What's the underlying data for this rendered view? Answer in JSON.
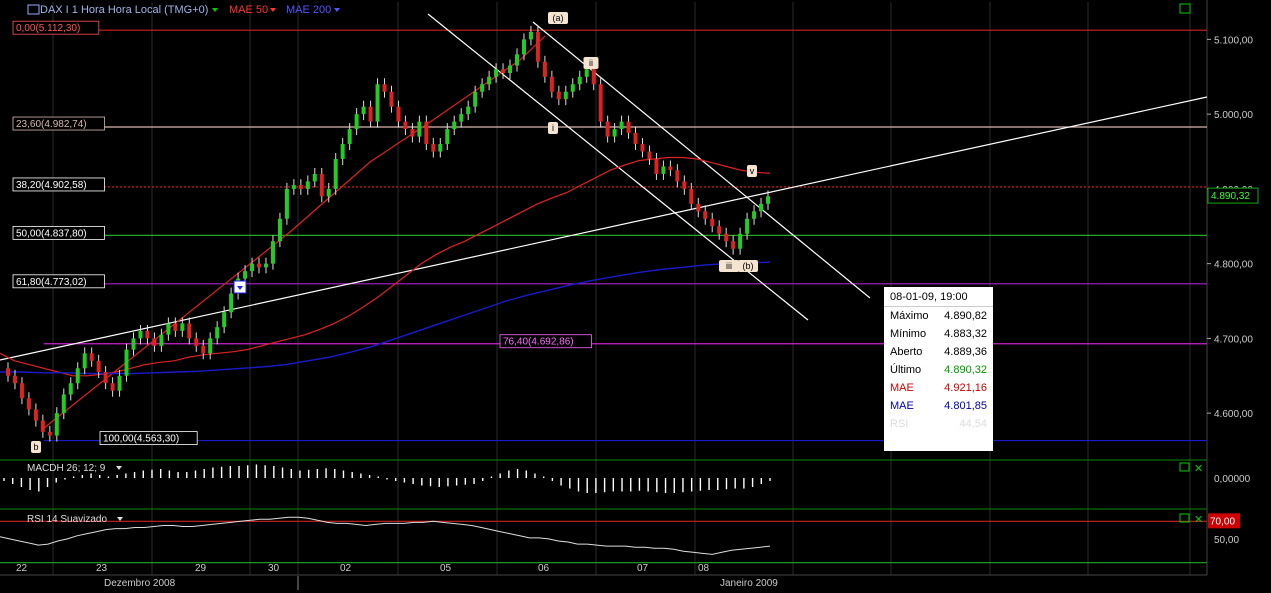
{
  "header": {
    "symbol_title": "DAX I 1 Hora Hora Local (TMG+0)",
    "ma1_label": "MAE 50",
    "ma2_label": "MAE 200"
  },
  "colors": {
    "background": "#000000",
    "candle_up": "#22cc22",
    "candle_down": "#dd2222",
    "mae50": "#dd2222",
    "mae200": "#1a1acc",
    "fib_100": "#1a1acc",
    "fib_0": "#cc2222",
    "fib_236": "#d8b8b0",
    "fib_50": "#22aa22",
    "fib_618": "#aa22cc",
    "fib_764": "#cc22cc",
    "rsi_70": "#cc2222",
    "white_line": "#ffffff",
    "grid": "#2a2a2a"
  },
  "fib_labels": [
    {
      "text": "0,00(5.112,30)",
      "value": 5112.3,
      "color": "#cc2222",
      "tagcolor": "#ff5555"
    },
    {
      "text": "23,60(4.982,74)",
      "value": 4982.74,
      "color": "#d8b8b0",
      "tagcolor": "#d8b8b0"
    },
    {
      "text": "38,20(4.902,58)",
      "value": 4902.58,
      "color": "#dd2222",
      "tagcolor": "#ffffff",
      "dotted": true
    },
    {
      "text": "50,00(4.837,80)",
      "value": 4837.8,
      "color": "#22aa22",
      "tagcolor": "#ffffff"
    },
    {
      "text": "61,80(4.773,02)",
      "value": 4773.02,
      "color": "#aa22cc",
      "tagcolor": "#ffffff"
    },
    {
      "text": "76,40(4.692,86)",
      "value": 4692.86,
      "color": "#cc22cc",
      "tagcolor": "#ff66ff"
    },
    {
      "text": "100,00(4.563,30)",
      "value": 4563.3,
      "color": "#1a1acc",
      "tagcolor": "#ffffff"
    }
  ],
  "wave_labels": [
    "(a)",
    "ii",
    "i",
    "v",
    "iii",
    "(b)",
    "b",
    "iv"
  ],
  "last_price_tag": "4.890,32",
  "tooltip": {
    "header": "08-01-09, 19:00",
    "rows": [
      {
        "label": "Máximo",
        "value": "4.890,82",
        "color": "#000000"
      },
      {
        "label": "Mínimo",
        "value": "4.883,32",
        "color": "#000000"
      },
      {
        "label": "Aberto",
        "value": "4.889,36",
        "color": "#000000"
      },
      {
        "label": "Último",
        "value": "4.890,32",
        "color": "#009900"
      },
      {
        "label": "MAE",
        "value": "4.921,16",
        "color": "#cc0000"
      },
      {
        "label": "MAE",
        "value": "4.801,85",
        "color": "#0000aa"
      },
      {
        "label": "RSI",
        "value": "44,54",
        "color": "#dddddd"
      }
    ]
  },
  "macd": {
    "label": "MACDH 26; 12; 9",
    "axis_value": "0,00000",
    "values": [
      -0.2,
      -0.4,
      -0.6,
      -0.8,
      -0.9,
      -0.6,
      -0.3,
      -0.1,
      0.1,
      0.2,
      0.3,
      0.2,
      0.1,
      0.2,
      0.3,
      0.4,
      0.5,
      0.55,
      0.6,
      0.5,
      0.4,
      0.4,
      0.5,
      0.6,
      0.7,
      0.75,
      0.8,
      0.8,
      0.85,
      0.9,
      0.85,
      0.8,
      0.7,
      0.6,
      0.5,
      0.55,
      0.6,
      0.65,
      0.6,
      0.5,
      0.4,
      0.3,
      0.2,
      0.1,
      -0.1,
      -0.2,
      -0.3,
      -0.4,
      -0.5,
      -0.55,
      -0.6,
      -0.55,
      -0.5,
      -0.45,
      -0.4,
      -0.2,
      0.1,
      0.3,
      0.5,
      0.6,
      0.5,
      0.3,
      0.1,
      -0.2,
      -0.5,
      -0.7,
      -0.9,
      -1.0,
      -1.0,
      -0.95,
      -0.9,
      -0.9,
      -0.9,
      -0.85,
      -0.9,
      -0.95,
      -1.0,
      -1.0,
      -0.95,
      -0.9,
      -0.85,
      -0.8,
      -0.8,
      -0.75,
      -0.7,
      -0.7,
      -0.6,
      -0.4,
      -0.2
    ]
  },
  "rsi": {
    "label": "RSI 14 Suavizado",
    "upper_tag": "70,00",
    "lower_tick": "50,00",
    "upper": 70,
    "lower": 30,
    "ylim": [
      20,
      80
    ],
    "values": [
      55,
      53,
      51,
      49,
      47,
      48,
      51,
      53,
      56,
      58,
      60,
      62,
      63,
      63,
      64,
      64,
      65,
      66,
      66,
      65,
      65,
      66,
      67,
      68,
      69,
      70,
      71,
      72,
      72,
      73,
      74,
      74,
      73,
      71,
      69,
      68,
      68,
      67,
      66,
      67,
      68,
      68,
      68,
      69,
      69,
      70,
      69,
      68,
      67,
      66,
      64,
      62,
      60,
      58,
      56,
      54,
      54,
      53,
      51,
      50,
      48,
      48,
      47,
      46,
      46,
      46,
      45,
      45,
      44,
      44,
      43,
      41,
      40,
      39,
      38,
      40,
      42,
      43,
      44,
      45,
      46
    ]
  },
  "axis": {
    "price_ticks": [
      "5.100,00",
      "5.000,00",
      "4.900,00",
      "4.800,00",
      "4.700,00",
      "4.600,00"
    ],
    "date_ticks": [
      "22",
      "23",
      "29",
      "30",
      "02",
      "05",
      "06",
      "07",
      "08"
    ],
    "month_labels": [
      "Dezembro 2008",
      "Janeiro 2009"
    ]
  },
  "chart_data": {
    "type": "candlestick",
    "title": "DAX I 1 Hora Hora Local (TMG+0)",
    "ylim": [
      4540,
      5150
    ],
    "date_ticks": [
      "22",
      "23",
      "29",
      "30",
      "02",
      "05",
      "06",
      "07",
      "08"
    ],
    "month_labels": [
      "Dezembro 2008",
      "Janeiro 2009"
    ],
    "close": [
      4650,
      4640,
      4620,
      4605,
      4590,
      4575,
      4570,
      4600,
      4625,
      4640,
      4660,
      4680,
      4670,
      4655,
      4640,
      4630,
      4650,
      4685,
      4700,
      4710,
      4700,
      4690,
      4705,
      4720,
      4710,
      4720,
      4700,
      4690,
      4680,
      4700,
      4715,
      4735,
      4760,
      4780,
      4790,
      4800,
      4795,
      4800,
      4830,
      4860,
      4900,
      4905,
      4900,
      4910,
      4920,
      4890,
      4900,
      4940,
      4960,
      4980,
      5000,
      5010,
      4990,
      5040,
      5030,
      5010,
      4990,
      4980,
      4970,
      4990,
      4960,
      4950,
      4960,
      4980,
      4990,
      5000,
      5010,
      5030,
      5040,
      5050,
      5060,
      5055,
      5065,
      5080,
      5100,
      5110,
      5070,
      5050,
      5030,
      5020,
      5030,
      5040,
      5050,
      5060,
      5040,
      4990,
      4970,
      4980,
      4990,
      4975,
      4960,
      4950,
      4940,
      4920,
      4930,
      4925,
      4910,
      4900,
      4880,
      4870,
      4860,
      4850,
      4840,
      4830,
      4820,
      4840,
      4860,
      4870,
      4880,
      4890
    ],
    "series": [
      {
        "name": "MAE 50",
        "values": [
          4680,
          4670,
          4665,
          4660,
          4655,
          4650,
          4650,
          4652,
          4655,
          4660,
          4665,
          4668,
          4670,
          4675,
          4678,
          4680,
          4682,
          4685,
          4690,
          4695,
          4700,
          4705,
          4712,
          4720,
          4730,
          4742,
          4755,
          4770,
          4785,
          4800,
          4812,
          4822,
          4830,
          4840,
          4850,
          4860,
          4870,
          4880,
          4888,
          4895,
          4905,
          4915,
          4925,
          4932,
          4938,
          4940,
          4942,
          4942,
          4940,
          4935,
          4930,
          4925,
          4922,
          4921
        ]
      },
      {
        "name": "MAE 200",
        "values": [
          4655,
          4655,
          4654,
          4654,
          4653,
          4653,
          4653,
          4654,
          4655,
          4656,
          4658,
          4660,
          4662,
          4665,
          4670,
          4675,
          4682,
          4690,
          4700,
          4710,
          4720,
          4730,
          4740,
          4750,
          4758,
          4765,
          4772,
          4778,
          4783,
          4788,
          4792,
          4795,
          4798,
          4800,
          4801,
          4802
        ]
      }
    ]
  }
}
